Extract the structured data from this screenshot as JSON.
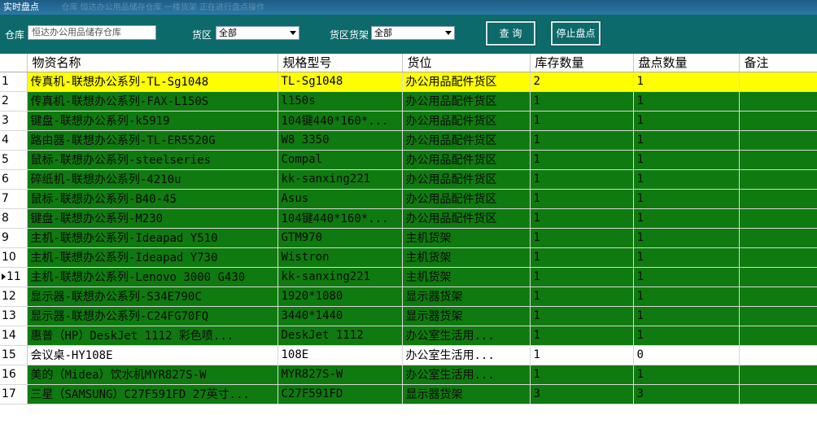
{
  "window": {
    "title": "实时盘点",
    "title_ghost": "仓库  恒达办公用品储存仓库  一楼货架  正在进行盘点操作"
  },
  "toolbar": {
    "warehouse_label": "仓库",
    "warehouse_value": "恒达办公用品储存仓库",
    "area_label": "货区",
    "area_value": "全部",
    "shelf_label": "货区货架",
    "shelf_value": "全部",
    "query_button": "查 询",
    "stop_button": "停止盘点"
  },
  "table": {
    "headers": [
      "物资名称",
      "规格型号",
      "货位",
      "库存数量",
      "盘点数量",
      "备注"
    ],
    "current_row_index": 11,
    "rows": [
      {
        "no": "1",
        "color": "yellow",
        "name": "传真机-联想办公系列-TL-Sg1048",
        "spec": "TL-Sg1048",
        "loc": "办公用品配件货区",
        "stock": "2",
        "count": "1",
        "note": ""
      },
      {
        "no": "2",
        "color": "green",
        "name": "传真机-联想办公系列-FAX-L150S",
        "spec": "l150s",
        "loc": "办公用品配件货区",
        "stock": "1",
        "count": "1",
        "note": ""
      },
      {
        "no": "3",
        "color": "green",
        "name": "键盘-联想办公系列-k5919",
        "spec": "104键440*160*...",
        "loc": "办公用品配件货区",
        "stock": "1",
        "count": "1",
        "note": ""
      },
      {
        "no": "4",
        "color": "green",
        "name": "路由器-联想办公系列-TL-ER5520G",
        "spec": "W8 3350",
        "loc": "办公用品配件货区",
        "stock": "1",
        "count": "1",
        "note": ""
      },
      {
        "no": "5",
        "color": "green",
        "name": "鼠标-联想办公系列-steelseries",
        "spec": "Compal",
        "loc": "办公用品配件货区",
        "stock": "1",
        "count": "1",
        "note": ""
      },
      {
        "no": "6",
        "color": "green",
        "name": "碎纸机-联想办公系列-4210u",
        "spec": "kk-sanxing221",
        "loc": "办公用品配件货区",
        "stock": "1",
        "count": "1",
        "note": ""
      },
      {
        "no": "7",
        "color": "green",
        "name": "鼠标-联想办公系列-B40-45",
        "spec": "Asus",
        "loc": "办公用品配件货区",
        "stock": "1",
        "count": "1",
        "note": ""
      },
      {
        "no": "8",
        "color": "green",
        "name": "键盘-联想办公系列-M230",
        "spec": "104键440*160*...",
        "loc": "办公用品配件货区",
        "stock": "1",
        "count": "1",
        "note": ""
      },
      {
        "no": "9",
        "color": "green",
        "name": "主机-联想办公系列-Ideapad Y510",
        "spec": "GTM970",
        "loc": "主机货架",
        "stock": "1",
        "count": "1",
        "note": ""
      },
      {
        "no": "10",
        "color": "green",
        "name": "主机-联想办公系列-Ideapad Y730",
        "spec": "Wistron",
        "loc": "主机货架",
        "stock": "1",
        "count": "1",
        "note": ""
      },
      {
        "no": "11",
        "color": "green",
        "name": "主机-联想办公系列-Lenovo 3000 G430",
        "spec": "kk-sanxing221",
        "loc": "主机货架",
        "stock": "1",
        "count": "1",
        "note": ""
      },
      {
        "no": "12",
        "color": "green",
        "name": "显示器-联想办公系列-S34E790C",
        "spec": "1920*1080",
        "loc": "显示器货架",
        "stock": "1",
        "count": "1",
        "note": ""
      },
      {
        "no": "13",
        "color": "green",
        "name": "显示器-联想办公系列-C24FG70FQ",
        "spec": "3440*1440",
        "loc": "显示器货架",
        "stock": "1",
        "count": "1",
        "note": ""
      },
      {
        "no": "14",
        "color": "green",
        "name": " 惠普（HP）DeskJet 1112 彩色喷...",
        "spec": "DeskJet 1112",
        "loc": "办公室生活用...",
        "stock": "1",
        "count": "1",
        "note": ""
      },
      {
        "no": "15",
        "color": "white",
        "name": "会议桌-HY108E",
        "spec": "108E",
        "loc": "办公室生活用...",
        "stock": "1",
        "count": "0",
        "note": ""
      },
      {
        "no": "16",
        "color": "green",
        "name": "美的（Midea）饮水机MYR827S-W",
        "spec": "MYR827S-W",
        "loc": "办公室生活用...",
        "stock": "1",
        "count": "1",
        "note": ""
      },
      {
        "no": "17",
        "color": "green",
        "name": "三星（SAMSUNG）C27F591FD 27英寸...",
        "spec": "C27F591FD",
        "loc": "显示器货架",
        "stock": "3",
        "count": "3",
        "note": ""
      }
    ]
  },
  "colors": {
    "toolbar": "#0d6a6a",
    "row_green": "#0f7a0f",
    "row_yellow": "#ffff00",
    "row_white": "#ffffff"
  },
  "icons": {
    "dropdown": "chevron-down-icon",
    "row_pointer": "row-pointer-icon"
  }
}
